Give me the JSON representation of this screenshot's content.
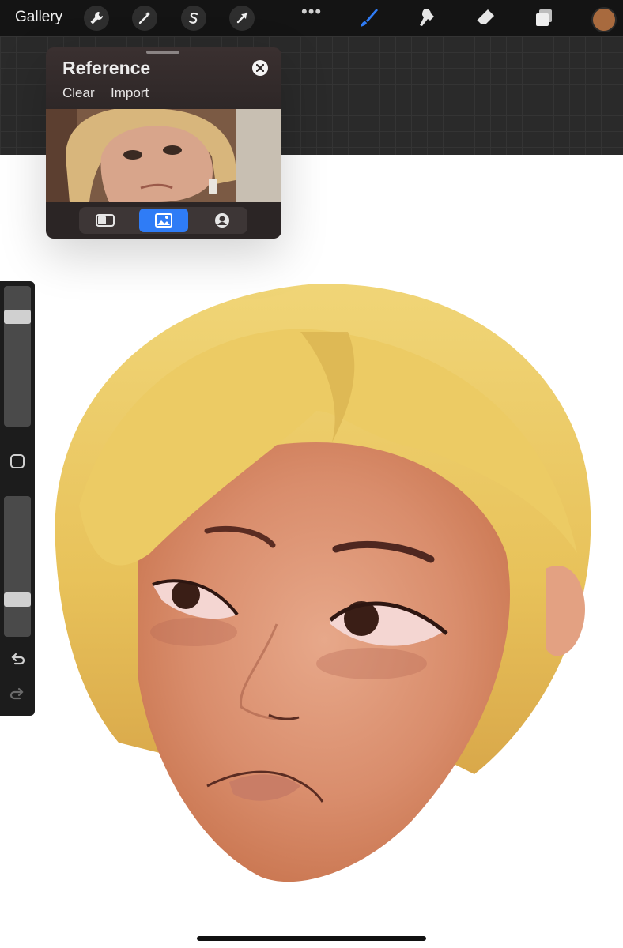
{
  "toolbar": {
    "gallery_label": "Gallery",
    "actions_icon": "wrench-icon",
    "adjustments_icon": "magic-wand-icon",
    "selection_icon": "selection-s-icon",
    "transform_icon": "arrow-cursor-icon",
    "more_label": "•••",
    "tools": [
      "brush-icon",
      "smudge-icon",
      "eraser-icon",
      "layers-icon"
    ],
    "active_tool": "brush-icon",
    "accent_color": "#2f7cf6",
    "current_color": "#a86a3e"
  },
  "reference": {
    "title": "Reference",
    "clear_label": "Clear",
    "import_label": "Import",
    "tabs": [
      "canvas-tab-icon",
      "image-tab-icon",
      "face-tab-icon"
    ],
    "active_tab": "image-tab-icon"
  },
  "sidebar": {
    "brush_size_level": 0.81,
    "opacity_level": 0.24,
    "modify_icon": "square-icon",
    "undo_icon": "undo-icon",
    "redo_icon": "redo-icon"
  },
  "colors": {
    "hair": "#e8c25a",
    "skin": "#d98d6c",
    "canvas": "#ffffff"
  }
}
